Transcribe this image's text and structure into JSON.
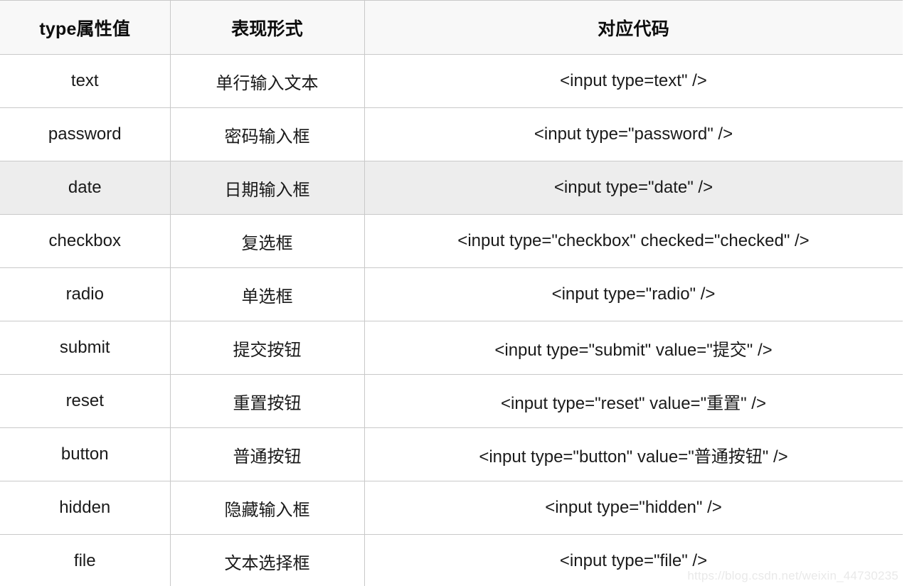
{
  "table": {
    "columns": [
      {
        "key": "type",
        "label": "type属性值"
      },
      {
        "key": "form",
        "label": "表现形式"
      },
      {
        "key": "code",
        "label": "对应代码"
      }
    ],
    "rows": [
      {
        "type": "text",
        "form": "单行输入文本",
        "code": "<input type=text\" />",
        "highlight": false
      },
      {
        "type": "password",
        "form": "密码输入框",
        "code": "<input type=\"password\"  />",
        "highlight": false
      },
      {
        "type": "date",
        "form": "日期输入框",
        "code": "<input type=\"date\" />",
        "highlight": true
      },
      {
        "type": "checkbox",
        "form": "复选框",
        "code": "<input type=\"checkbox\" checked=\"checked\"  />",
        "highlight": false
      },
      {
        "type": "radio",
        "form": "单选框",
        "code": "<input type=\"radio\"  />",
        "highlight": false
      },
      {
        "type": "submit",
        "form": "提交按钮",
        "code": "<input type=\"submit\" value=\"提交\" />",
        "highlight": false
      },
      {
        "type": "reset",
        "form": "重置按钮",
        "code": "<input type=\"reset\" value=\"重置\"  />",
        "highlight": false
      },
      {
        "type": "button",
        "form": "普通按钮",
        "code": "<input type=\"button\" value=\"普通按钮\"  />",
        "highlight": false
      },
      {
        "type": "hidden",
        "form": "隐藏输入框",
        "code": "<input type=\"hidden\"  />",
        "highlight": false
      },
      {
        "type": "file",
        "form": "文本选择框",
        "code": "<input type=\"file\"  />",
        "highlight": false
      }
    ]
  },
  "watermark": {
    "text": "https://blog.csdn.net/weixin_44730235"
  },
  "colors": {
    "header_background": "#f8f8f8",
    "row_highlight_background": "#ededed",
    "border": "#c9c9c9",
    "text": "#1a1a1a",
    "watermark": "#e9e9e9"
  }
}
